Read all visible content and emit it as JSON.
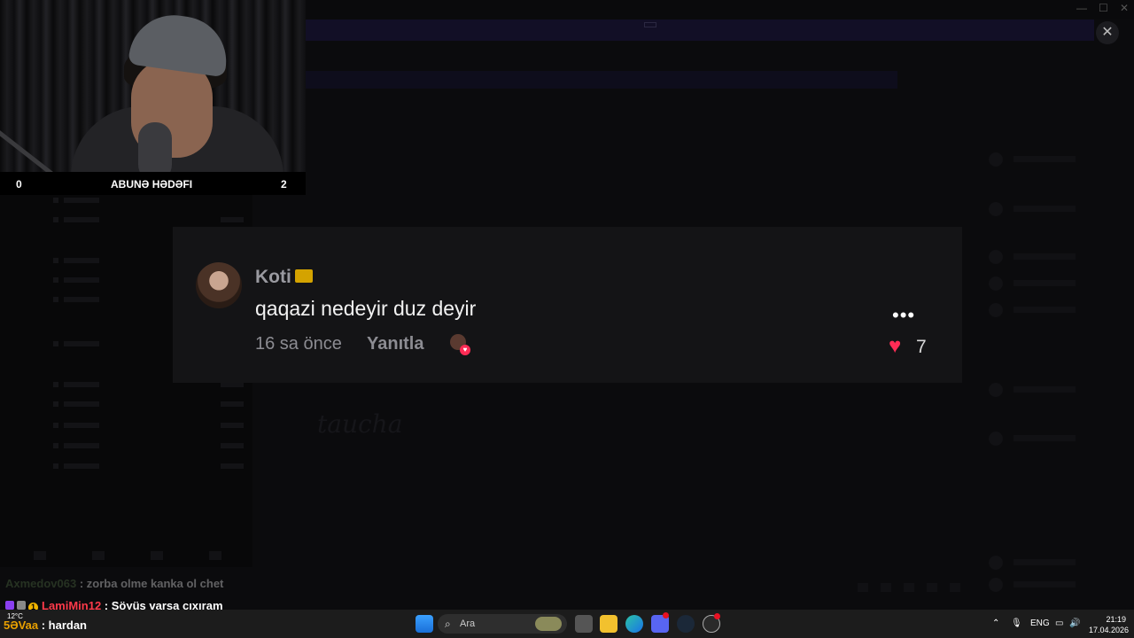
{
  "webcam": {
    "sub_goal": {
      "left_value": "0",
      "label": "ABUNƏ HƏDƏFI",
      "right_value": "2"
    }
  },
  "comment": {
    "username": "Koti",
    "text": "qaqazi nedeyir duz deyir",
    "time_ago": "16 sa önce",
    "reply_label": "Yanıtla",
    "like_count": "7",
    "more_icon": "more-dots-icon",
    "like_icon": "heart-icon"
  },
  "background_app": {
    "logo_text": "taucha",
    "close_symbol": "✕",
    "titlebar_controls": [
      "—",
      "☐",
      "✕"
    ]
  },
  "stream_chat": [
    {
      "name": "Axmedov063",
      "message": "zorba olme kanka ol chet",
      "faded": true
    },
    {
      "badge": "1",
      "name": "LamiMin12",
      "message": "Söyüş varsa çıxıram",
      "faded": false
    },
    {
      "name": "5ƏVaa",
      "message": "hardan",
      "faded": false
    }
  ],
  "taskbar": {
    "weather": "12°C",
    "search_placeholder": "Ara",
    "language": "ENG",
    "time": "21:19",
    "date": "17.04.2026",
    "apps": [
      "start-icon",
      "task-view-icon",
      "file-explorer-icon",
      "edge-icon",
      "discord-icon",
      "steam-icon",
      "app-icon"
    ],
    "notification_count": "5+"
  },
  "colors": {
    "like_red": "#fe2c55",
    "chat_name_red": "#ff3a4a",
    "taskbar_bg": "#1c1c1c",
    "comment_card_bg": "#141416"
  }
}
